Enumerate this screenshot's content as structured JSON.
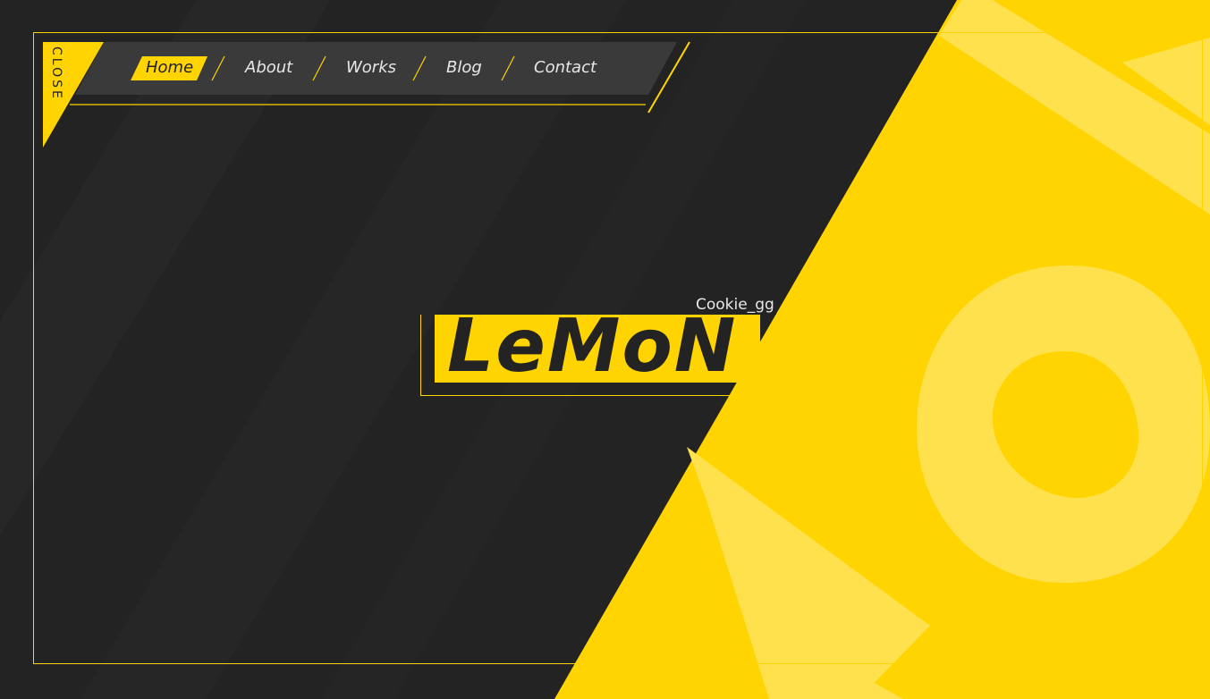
{
  "colors": {
    "accent": "#ffd400",
    "accent_light": "#ffe14d",
    "background": "#232323",
    "nav_background": "#3a3a3a",
    "text": "#e8e8e8"
  },
  "menu": {
    "close_label": "CLOSE",
    "items": [
      {
        "label": "Home",
        "active": true
      },
      {
        "label": "About",
        "active": false
      },
      {
        "label": "Works",
        "active": false
      },
      {
        "label": "Blog",
        "active": false
      },
      {
        "label": "Contact",
        "active": false
      }
    ]
  },
  "logo": {
    "title": "LeMoN",
    "subtitle": "Cookie_gg"
  },
  "decoration": {
    "letters": "NO"
  }
}
